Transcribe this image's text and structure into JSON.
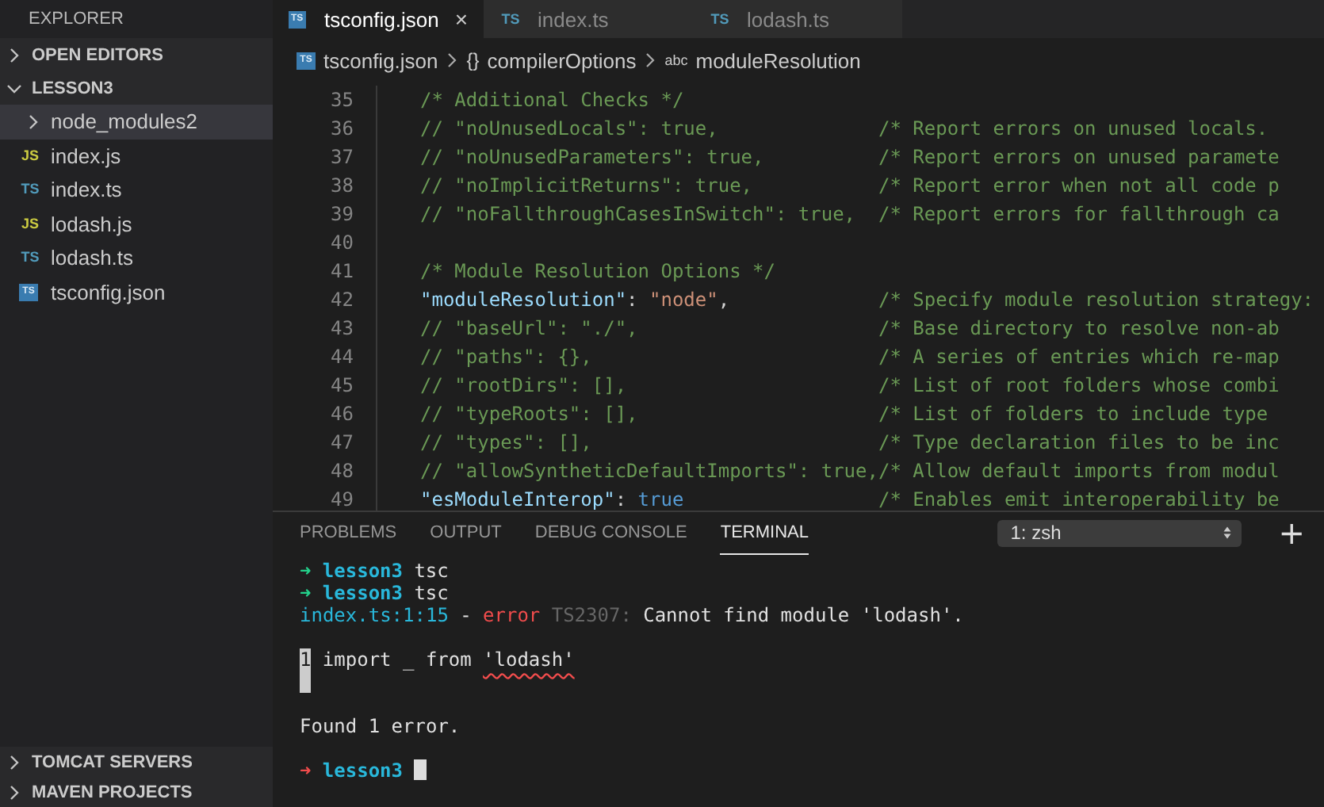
{
  "sidebar": {
    "title": "EXPLORER",
    "sections": [
      {
        "label": "OPEN EDITORS",
        "expanded": false
      },
      {
        "label": "LESSON3",
        "expanded": true,
        "children": [
          {
            "kind": "folder",
            "name": "node_modules2",
            "expanded": false,
            "selected": true
          },
          {
            "kind": "js",
            "icon_text": "JS",
            "name": "index.js",
            "selected": false
          },
          {
            "kind": "ts",
            "icon_text": "TS",
            "name": "index.ts",
            "selected": false
          },
          {
            "kind": "js",
            "icon_text": "JS",
            "name": "lodash.js",
            "selected": false
          },
          {
            "kind": "ts",
            "icon_text": "TS",
            "name": "lodash.ts",
            "selected": false
          },
          {
            "kind": "tsconfig",
            "icon_text": "TS",
            "name": "tsconfig.json",
            "selected": false
          }
        ]
      },
      {
        "label": "TOMCAT SERVERS",
        "expanded": false
      },
      {
        "label": "MAVEN PROJECTS",
        "expanded": false
      }
    ]
  },
  "tabs": [
    {
      "kind": "tsconfig",
      "icon_text": "TS",
      "label": "tsconfig.json",
      "selected": true,
      "close": "×"
    },
    {
      "kind": "ts",
      "icon_text": "TS",
      "label": "index.ts",
      "selected": false
    },
    {
      "kind": "ts",
      "icon_text": "TS",
      "label": "lodash.ts",
      "selected": false
    }
  ],
  "breadcrumb": [
    {
      "kind": "file",
      "icon_text": "TS",
      "label": "tsconfig.json"
    },
    {
      "kind": "object",
      "icon_text": "{}",
      "label": "compilerOptions"
    },
    {
      "kind": "string",
      "icon_text": "abc",
      "label": "moduleResolution"
    }
  ],
  "editor": {
    "lines": [
      {
        "number": "35",
        "code": [
          {
            "kind": "comment",
            "text": "/* Additional Checks */"
          }
        ]
      },
      {
        "number": "36",
        "code": [
          {
            "kind": "comment",
            "text": "// \"noUnusedLocals\": true,"
          }
        ],
        "note": "/* Report errors on unused locals."
      },
      {
        "number": "37",
        "code": [
          {
            "kind": "comment",
            "text": "// \"noUnusedParameters\": true,"
          }
        ],
        "note": "/* Report errors on unused paramete"
      },
      {
        "number": "38",
        "code": [
          {
            "kind": "comment",
            "text": "// \"noImplicitReturns\": true,"
          }
        ],
        "note": "/* Report error when not all code p"
      },
      {
        "number": "39",
        "code": [
          {
            "kind": "comment",
            "text": "// \"noFallthroughCasesInSwitch\": true,"
          }
        ],
        "note": "/* Report errors for fallthrough ca"
      },
      {
        "number": "40"
      },
      {
        "number": "41",
        "code": [
          {
            "kind": "comment",
            "text": "/* Module Resolution Options */"
          }
        ]
      },
      {
        "number": "42",
        "code": [
          {
            "kind": "key",
            "text": "\"moduleResolution\""
          },
          {
            "kind": "punct",
            "text": ": "
          },
          {
            "kind": "string",
            "text": "\"node\""
          },
          {
            "kind": "punct",
            "text": ","
          }
        ],
        "note": "/* Specify module resolution strategy:"
      },
      {
        "number": "43",
        "code": [
          {
            "kind": "comment",
            "text": "// \"baseUrl\": \"./\","
          }
        ],
        "note": "/* Base directory to resolve non-ab"
      },
      {
        "number": "44",
        "code": [
          {
            "kind": "comment",
            "text": "// \"paths\": {},"
          }
        ],
        "note": "/* A series of entries which re-map"
      },
      {
        "number": "45",
        "code": [
          {
            "kind": "comment",
            "text": "// \"rootDirs\": [],"
          }
        ],
        "note": "/* List of root folders whose combi"
      },
      {
        "number": "46",
        "code": [
          {
            "kind": "comment",
            "text": "// \"typeRoots\": [],"
          }
        ],
        "note": "/* List of folders to include type"
      },
      {
        "number": "47",
        "code": [
          {
            "kind": "comment",
            "text": "// \"types\": [],"
          }
        ],
        "note": "/* Type declaration files to be inc"
      },
      {
        "number": "48",
        "code": [
          {
            "kind": "comment",
            "text": "// \"allowSyntheticDefaultImports\": true,"
          }
        ],
        "note": "/* Allow default imports from modul"
      },
      {
        "number": "49",
        "code": [
          {
            "kind": "key",
            "text": "\"esModuleInterop\""
          },
          {
            "kind": "punct",
            "text": ": "
          },
          {
            "kind": "keyword",
            "text": "true"
          }
        ],
        "note": "/* Enables emit interoperability be"
      }
    ]
  },
  "panel": {
    "tabs": [
      {
        "label": "PROBLEMS",
        "selected": false
      },
      {
        "label": "OUTPUT",
        "selected": false
      },
      {
        "label": "DEBUG CONSOLE",
        "selected": false
      },
      {
        "label": "TERMINAL",
        "selected": true
      }
    ],
    "terminal_select": "1: zsh",
    "add": "+",
    "terminal": [
      {
        "kind": "prompt",
        "segments": [
          {
            "kind": "arrow-ok",
            "text": "➜"
          },
          {
            "kind": "dir",
            "text": "lesson3"
          },
          {
            "kind": "plain",
            "text": "tsc"
          }
        ]
      },
      {
        "kind": "prompt",
        "segments": [
          {
            "kind": "arrow-ok",
            "text": "➜"
          },
          {
            "kind": "dir",
            "text": "lesson3"
          },
          {
            "kind": "plain",
            "text": "tsc"
          }
        ]
      },
      {
        "kind": "diagnostic",
        "segments": [
          {
            "kind": "file",
            "text": "index.ts:1:15"
          },
          {
            "kind": "plain",
            "text": "-"
          },
          {
            "kind": "error",
            "text": "error"
          },
          {
            "kind": "muted",
            "text": "TS2307:"
          },
          {
            "kind": "plain",
            "text": "Cannot find module 'lodash'."
          }
        ]
      },
      {
        "kind": "source",
        "segments": [
          {
            "kind": "gutter",
            "text": "1"
          },
          {
            "kind": "plain",
            "text": "import _ from"
          },
          {
            "kind": "squiggle",
            "text": "'lodash'"
          }
        ]
      },
      {
        "kind": "summary",
        "segments": [
          {
            "kind": "plain",
            "text": "Found 1 error."
          }
        ]
      },
      {
        "kind": "prompt",
        "segments": [
          {
            "kind": "arrow-fail",
            "text": "➜"
          },
          {
            "kind": "dir",
            "text": "lesson3"
          },
          {
            "kind": "cursor"
          }
        ]
      }
    ]
  }
}
